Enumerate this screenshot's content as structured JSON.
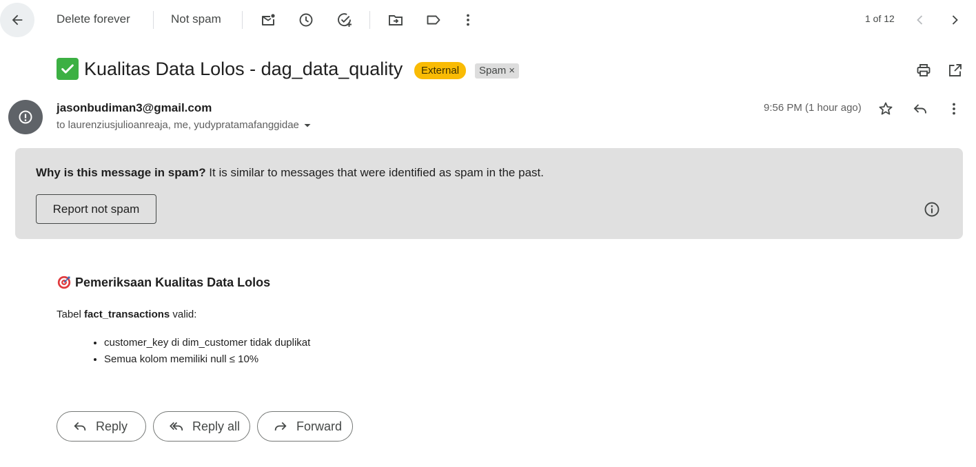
{
  "toolbar": {
    "delete_forever": "Delete forever",
    "not_spam": "Not spam",
    "pager_text": "1 of 12",
    "icons": [
      "back-arrow-icon",
      "mark-unread-icon",
      "snooze-clock-icon",
      "add-task-icon",
      "move-to-folder-icon",
      "label-icon",
      "more-vertical-icon",
      "chevron-left-icon",
      "chevron-right-icon"
    ]
  },
  "subject": {
    "text": "Kualitas Data Lolos - dag_data_quality",
    "emoji": "✅",
    "badge_external": "External",
    "badge_spam": "Spam",
    "badge_spam_close": "×"
  },
  "message": {
    "sender": "jasonbudiman3@gmail.com",
    "recipients": "to laurenziusjulioanreaja, me, yudypratamafanggidae",
    "time": "9:56 PM (1 hour ago)"
  },
  "spam_banner": {
    "question": "Why is this message in spam?",
    "explanation": " It is similar to messages that were identified as spam in the past.",
    "report_button": "Report not spam"
  },
  "body": {
    "heading": "Pemeriksaan Kualitas Data Lolos",
    "line_prefix": "Tabel ",
    "table_name": "fact_transactions",
    "line_suffix": " valid:",
    "bullets": [
      "customer_key di dim_customer tidak duplikat",
      "Semua kolom memiliki null ≤ 10%"
    ]
  },
  "actions": {
    "reply": "Reply",
    "reply_all": "Reply all",
    "forward": "Forward"
  },
  "colors": {
    "external_badge": "#f9bb04",
    "spam_banner_bg": "#e0e0e0",
    "check_green": "#3cb043",
    "avatar_bg": "#5f6368"
  }
}
